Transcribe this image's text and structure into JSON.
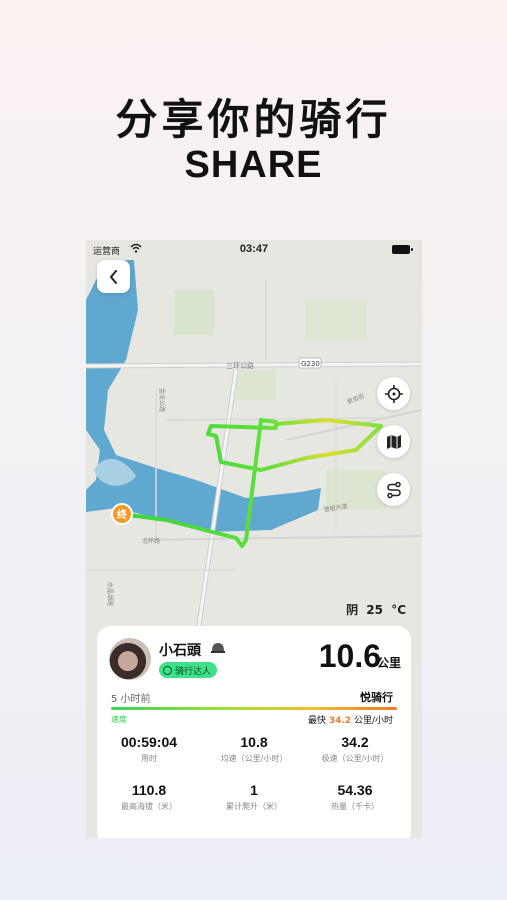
{
  "hero": {
    "title": "分享你的骑行",
    "subtitle": "SHARE"
  },
  "statusbar": {
    "carrier": "运营商",
    "time": "03:47"
  },
  "map": {
    "labels": {
      "road_top": "三环公路",
      "road_badge": "G230",
      "road_left": "金龙公路",
      "road_right": "紫金街",
      "road_mid": "雪梧大道",
      "road_bottom": "北环路",
      "road_bottom_left": "水晶湖路"
    },
    "start_marker": "终",
    "weather": {
      "condition": "阴",
      "temp": "25",
      "unit": "°C"
    }
  },
  "card": {
    "username": "小石頭",
    "badge": "骑行达人",
    "distance": "10.6",
    "distance_unit": "公里",
    "time_ago": "5 小时前",
    "brand": "悦骑行",
    "speed_label": "速度",
    "fastest_prefix": "最快",
    "fastest_value": "34.2",
    "fastest_unit": "公里/小时",
    "stats": [
      {
        "value": "00:59:04",
        "label": "用时"
      },
      {
        "value": "10.8",
        "label": "均速（公里/小时）"
      },
      {
        "value": "34.2",
        "label": "极速（公里/小时）"
      },
      {
        "value": "110.8",
        "label": "最高海拔（米）"
      },
      {
        "value": "1",
        "label": "累计爬升（米）"
      },
      {
        "value": "54.36",
        "label": "热量（千卡）"
      }
    ]
  },
  "colors": {
    "route_start": "#39d440",
    "route_end": "#f0d030",
    "water": "#5fa8d0",
    "map_bg": "#e6e7e1"
  }
}
